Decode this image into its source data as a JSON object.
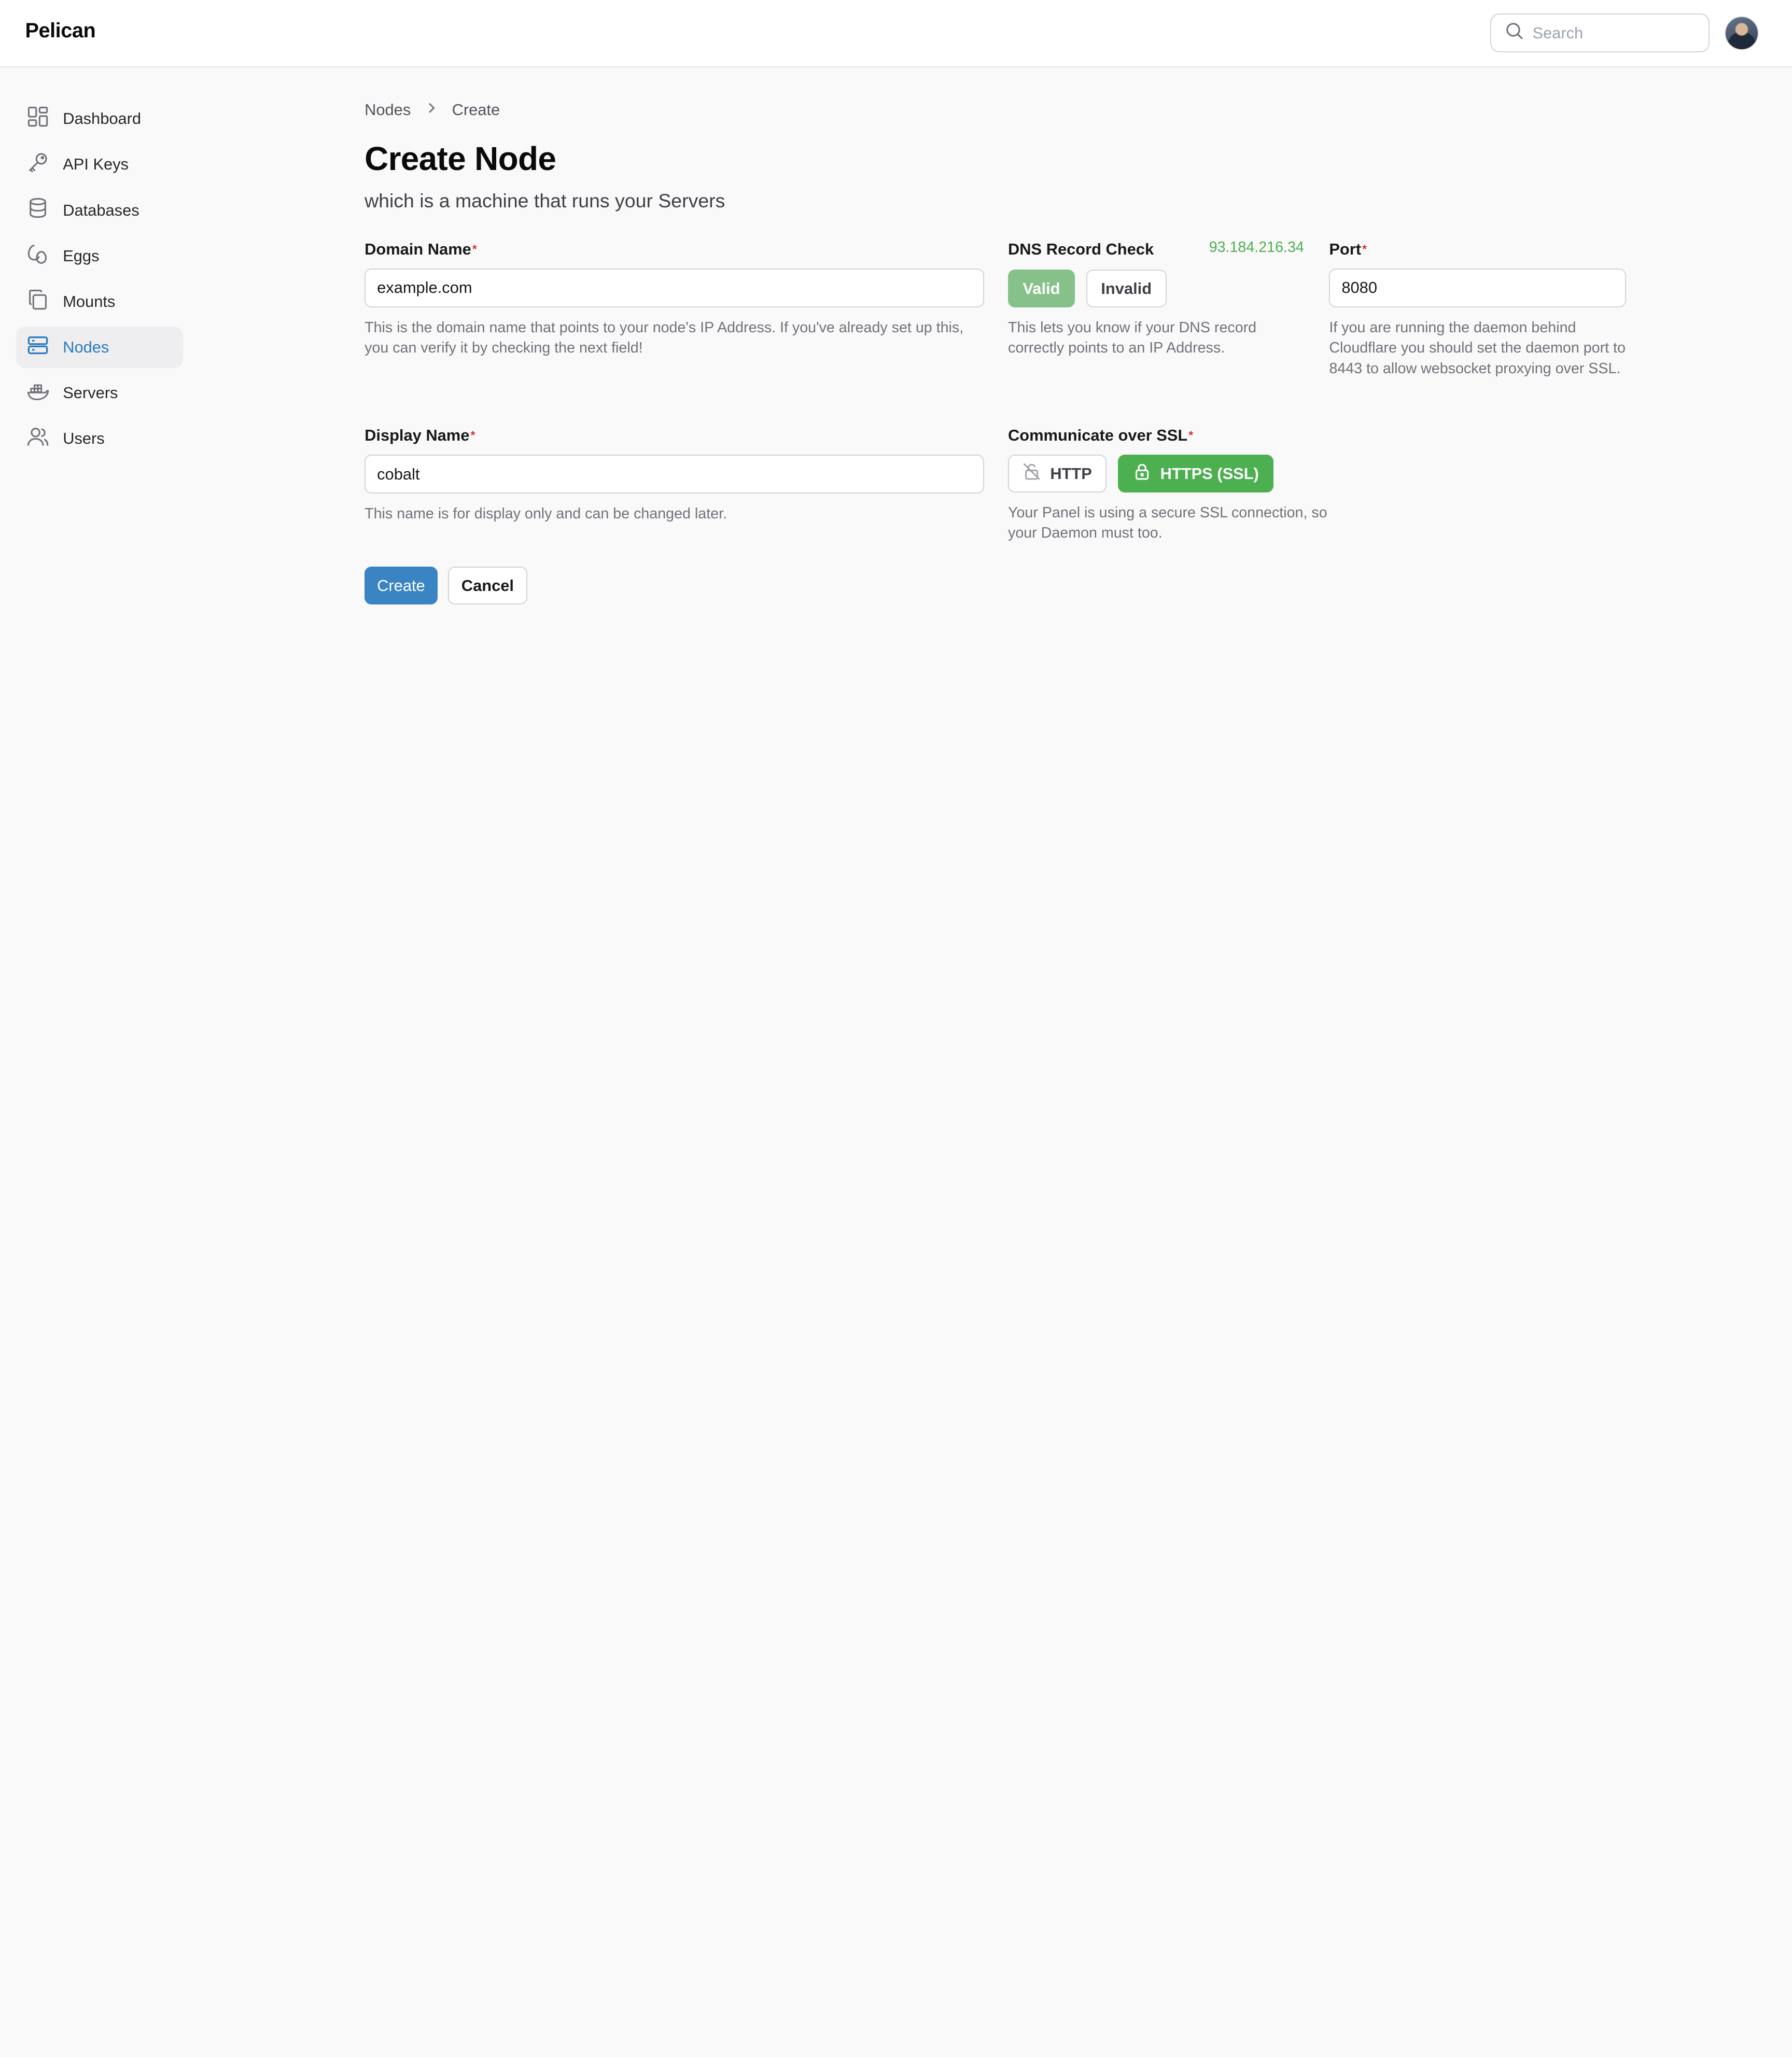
{
  "app": {
    "title": "Pelican"
  },
  "search": {
    "placeholder": "Search"
  },
  "sidebar": {
    "items": [
      {
        "label": "Dashboard"
      },
      {
        "label": "API Keys"
      },
      {
        "label": "Databases"
      },
      {
        "label": "Eggs"
      },
      {
        "label": "Mounts"
      },
      {
        "label": "Nodes",
        "active": true
      },
      {
        "label": "Servers"
      },
      {
        "label": "Users"
      }
    ]
  },
  "breadcrumb": {
    "parent": "Nodes",
    "current": "Create"
  },
  "page": {
    "title": "Create Node",
    "subtitle": "which is a machine that runs your Servers"
  },
  "form": {
    "domain": {
      "label": "Domain Name",
      "value": "example.com",
      "help": "This is the domain name that points to your node's IP Address. If you've already set up this, you can verify it by checking the next field!"
    },
    "dns": {
      "label": "DNS Record Check",
      "ip": "93.184.216.34",
      "valid_label": "Valid",
      "invalid_label": "Invalid",
      "help": "This lets you know if your DNS record correctly points to an IP Address."
    },
    "port": {
      "label": "Port",
      "value": "8080",
      "help": "If you are running the daemon behind Cloudflare you should set the daemon port to 8443 to allow websocket proxying over SSL."
    },
    "display_name": {
      "label": "Display Name",
      "value": "cobalt",
      "help": "This name is for display only and can be changed later."
    },
    "ssl": {
      "label": "Communicate over SSL",
      "http_label": "HTTP",
      "https_label": "HTTPS (SSL)",
      "help": "Your Panel is using a secure SSL connection, so your Daemon must too."
    },
    "required_marker": "*",
    "actions": {
      "create_label": "Create",
      "cancel_label": "Cancel"
    }
  },
  "colors": {
    "accent": "#3b84c4",
    "success": "#4caf50",
    "success_soft": "#86c18a",
    "required": "#dc2626"
  }
}
